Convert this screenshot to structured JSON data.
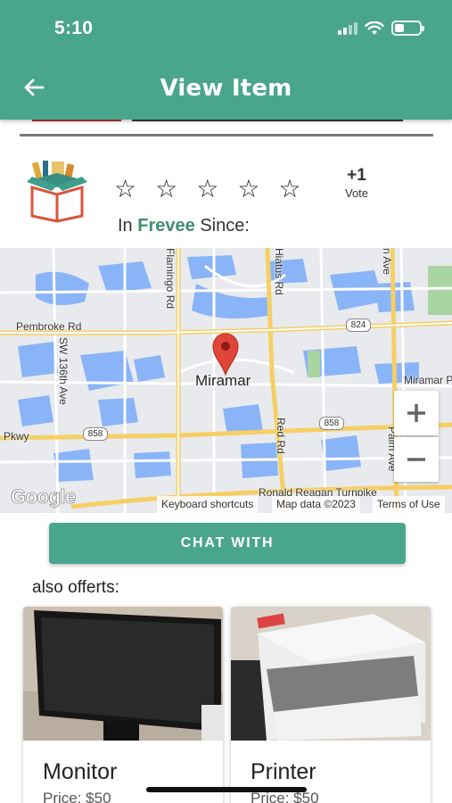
{
  "status_bar": {
    "time": "5:10"
  },
  "header": {
    "title": "View Item",
    "back_icon": "arrow-left-icon"
  },
  "seller": {
    "logo_icon": "open-box-logo",
    "rating": {
      "max": 5,
      "filled": 0,
      "icon": "star-outline-icon"
    },
    "vote": {
      "count": "+1",
      "label": "Vote"
    },
    "since": {
      "prefix": "In",
      "brand": "Frevee",
      "suffix": "Since:"
    }
  },
  "map": {
    "city": "Miramar",
    "roads": [
      "Pembroke Rd",
      "Flamingo Rd",
      "Hiatus Rd",
      "SW 136th Ave",
      "Red Rd",
      "Miramar P",
      "Pkwy",
      "Ronald Reagan Turnpike",
      "n Ave",
      "Palm Ave"
    ],
    "route_shields": [
      "824",
      "858",
      "858"
    ],
    "attribution": {
      "shortcuts": "Keyboard shortcuts",
      "data": "Map data ©2023",
      "terms": "Terms of Use"
    },
    "logo": "Google",
    "zoom_in": "+",
    "zoom_out": "−"
  },
  "chat_button": {
    "label": "CHAT WITH"
  },
  "also_offers": {
    "heading": "also offerts:",
    "items": [
      {
        "name": "Monitor",
        "price": "Price: $50"
      },
      {
        "name": "Printer",
        "price": "Price: $50"
      }
    ]
  },
  "colors": {
    "accent": "#4aa58d",
    "brand_text": "#3f8f6a",
    "map_water": "#8ab4f8",
    "map_road": "#f6cf65"
  }
}
